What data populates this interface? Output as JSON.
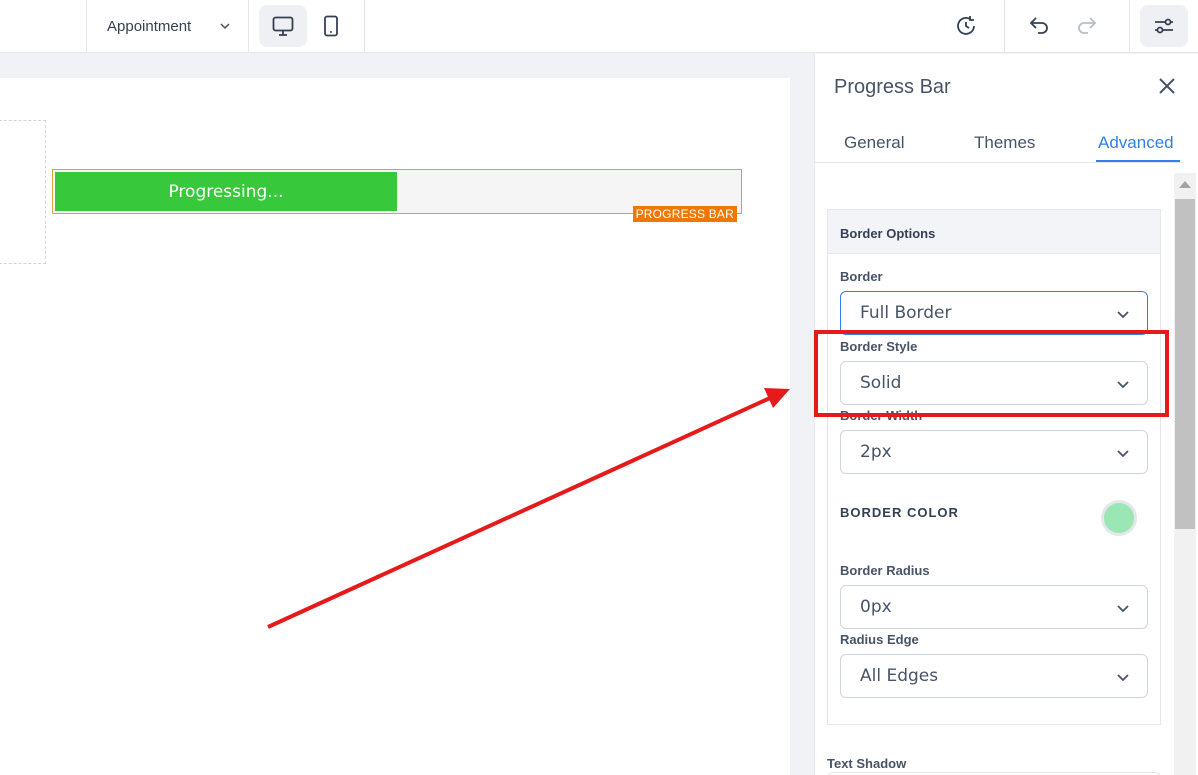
{
  "toolbar": {
    "page_selector": "Appointment",
    "icons": [
      "desktop-icon",
      "mobile-icon",
      "history-icon",
      "undo-icon",
      "redo-icon",
      "settings-sliders-icon"
    ]
  },
  "canvas": {
    "progress_bar": {
      "text": "Progressing...",
      "percent": 50,
      "tag": "PROGRESS BAR",
      "fill_color": "#37c83c"
    }
  },
  "panel": {
    "title": "Progress Bar",
    "tabs": [
      {
        "label": "General"
      },
      {
        "label": "Themes"
      },
      {
        "label": "Advanced",
        "active": true
      }
    ],
    "section_title": "Border Options",
    "fields": {
      "border_label": "Border",
      "border_value": "Full Border",
      "border_style_label": "Border Style",
      "border_style_value": "Solid",
      "border_width_label": "Border Width",
      "border_width_value": "2px",
      "border_color_label": "BORDER COLOR",
      "border_color": "#9ae6b4",
      "border_radius_label": "Border Radius",
      "border_radius_value": "0px",
      "radius_edge_label": "Radius Edge",
      "radius_edge_value": "All Edges"
    },
    "text_shadow_label": "Text Shadow"
  },
  "annotation_color": "#e51a1a"
}
